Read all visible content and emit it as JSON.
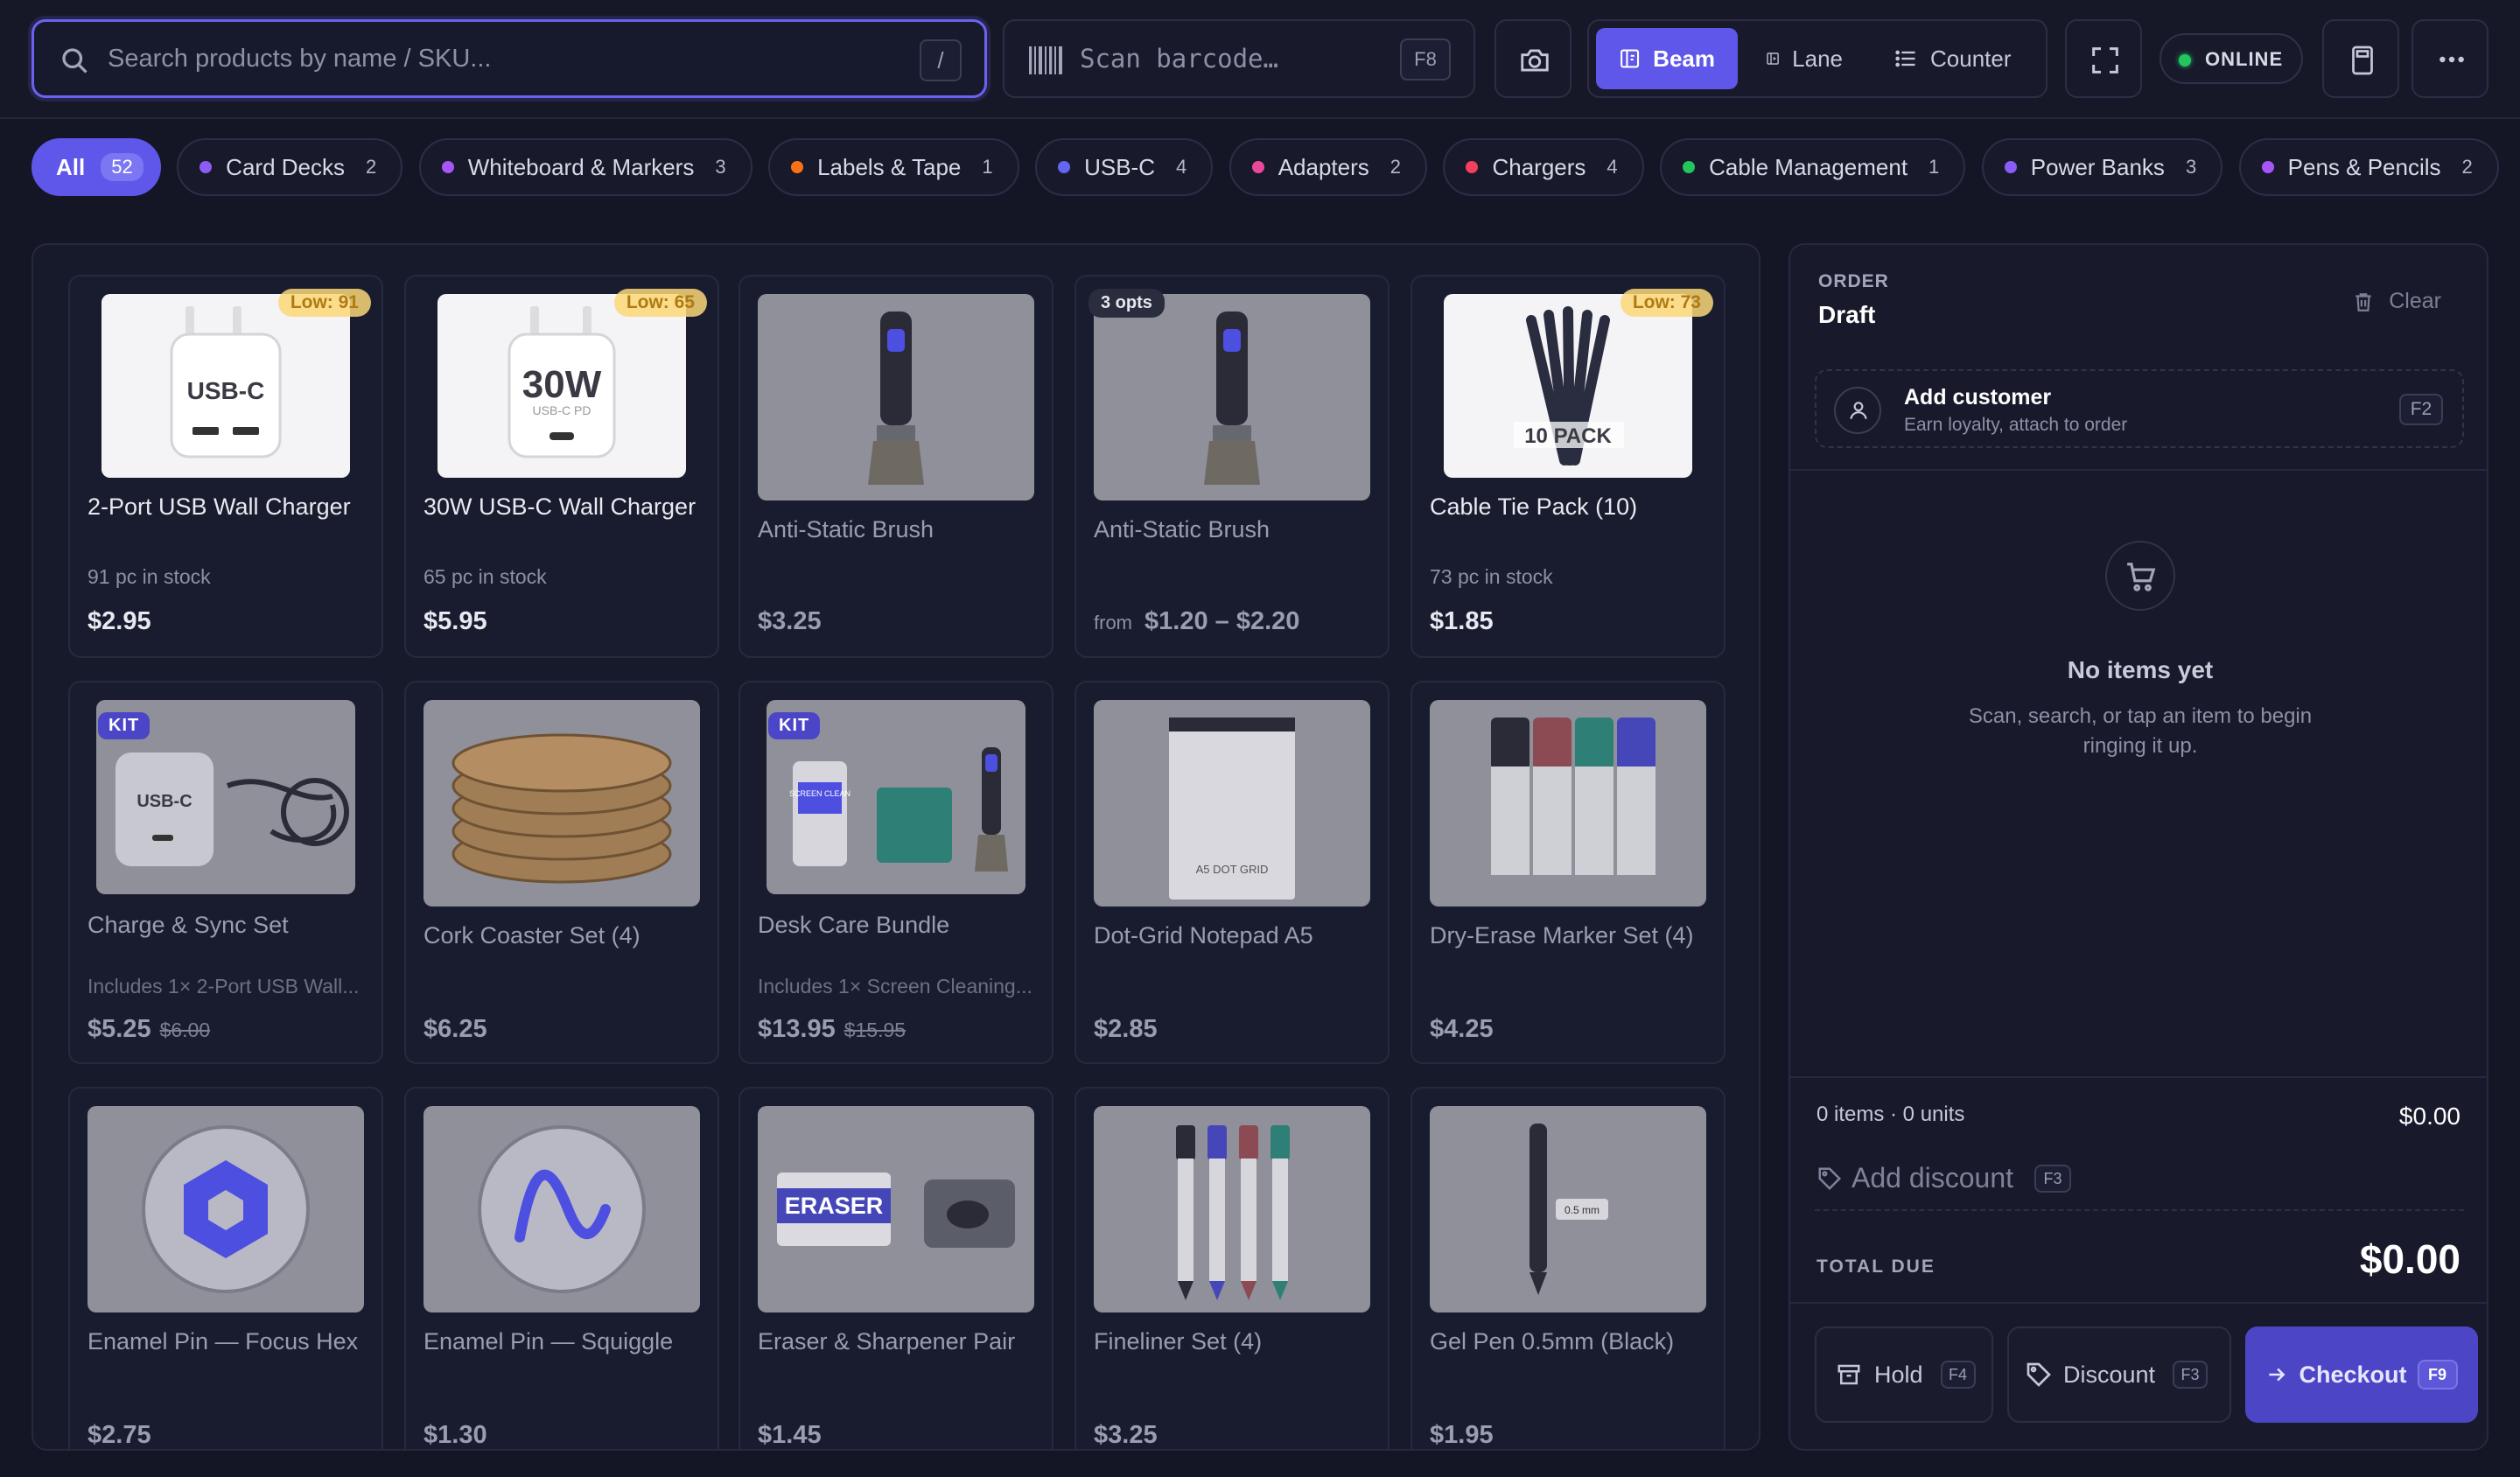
{
  "search": {
    "placeholder": "Search products by name / SKU...",
    "shortcut": "/"
  },
  "scan": {
    "placeholder": "Scan barcode…",
    "shortcut": "F8"
  },
  "modes": [
    {
      "label": "Beam",
      "active": true
    },
    {
      "label": "Lane",
      "active": false
    },
    {
      "label": "Counter",
      "active": false
    }
  ],
  "status": {
    "label": "ONLINE",
    "color": "#22c55e"
  },
  "accent": "#5e57ea",
  "categories": [
    {
      "label": "All",
      "count": "52",
      "active": true
    },
    {
      "label": "Card Decks",
      "count": "2",
      "color": "#8b5cf6"
    },
    {
      "label": "Whiteboard & Markers",
      "count": "3",
      "color": "#a855f7"
    },
    {
      "label": "Labels & Tape",
      "count": "1",
      "color": "#f97316"
    },
    {
      "label": "USB-C",
      "count": "4",
      "color": "#6366f1"
    },
    {
      "label": "Adapters",
      "count": "2",
      "color": "#ec4899"
    },
    {
      "label": "Chargers",
      "count": "4",
      "color": "#f43f5e"
    },
    {
      "label": "Cable Management",
      "count": "1",
      "color": "#22c55e"
    },
    {
      "label": "Power Banks",
      "count": "3",
      "color": "#8b5cf6"
    },
    {
      "label": "Pens & Pencils",
      "count": "2",
      "color": "#a855f7"
    }
  ],
  "products": [
    {
      "name": "2-Port USB Wall Charger",
      "stock": "91 pc in stock",
      "price": "$2.95",
      "badge": "Low: 91",
      "art": "USB-C"
    },
    {
      "name": "30W USB-C Wall Charger",
      "stock": "65 pc in stock",
      "price": "$5.95",
      "badge": "Low: 65",
      "art": "30W",
      "art_sub": "USB-C PD"
    },
    {
      "name": "Anti-Static Brush",
      "price": "$3.25"
    },
    {
      "name": "Anti-Static Brush",
      "price_from": "from",
      "price": "$1.20 – $2.20",
      "opts": "3 opts"
    },
    {
      "name": "Cable Tie Pack (10)",
      "stock": "73 pc in stock",
      "price": "$1.85",
      "badge": "Low: 73",
      "art": "10 PACK"
    },
    {
      "name": "Charge & Sync Set",
      "desc": "Includes 1× 2-Port USB Wall...",
      "price": "$5.25",
      "was": "$6.00",
      "kit": "KIT",
      "art": "USB-C"
    },
    {
      "name": "Cork Coaster Set (4)",
      "price": "$6.25"
    },
    {
      "name": "Desk Care Bundle",
      "desc": "Includes 1× Screen Cleaning...",
      "price": "$13.95",
      "was": "$15.95",
      "kit": "KIT",
      "art": "SCREEN CLEAN"
    },
    {
      "name": "Dot-Grid Notepad A5",
      "price": "$2.85",
      "art": "A5 DOT GRID"
    },
    {
      "name": "Dry-Erase Marker Set (4)",
      "price": "$4.25"
    },
    {
      "name": "Enamel Pin — Focus Hex",
      "price": "$2.75"
    },
    {
      "name": "Enamel Pin — Squiggle",
      "price": "$1.30"
    },
    {
      "name": "Eraser & Sharpener Pair",
      "price": "$1.45",
      "art": "ERASER"
    },
    {
      "name": "Fineliner Set (4)",
      "price": "$3.25"
    },
    {
      "name": "Gel Pen 0.5mm (Black)",
      "price": "$1.95",
      "art": "0.5 mm"
    }
  ],
  "order": {
    "label": "ORDER",
    "state": "Draft",
    "clear": "Clear",
    "customer": {
      "title": "Add customer",
      "subtitle": "Earn loyalty, attach to order",
      "shortcut": "F2"
    },
    "empty_title": "No items yet",
    "empty_body": "Scan, search, or tap an item to begin ringing it up.",
    "count_line": "0 items · 0 units",
    "subtotal": "$0.00",
    "add_discount": "Add discount",
    "add_discount_key": "F3",
    "total_label": "TOTAL DUE",
    "total": "$0.00",
    "hold": {
      "label": "Hold",
      "key": "F4"
    },
    "discount": {
      "label": "Discount",
      "key": "F3"
    },
    "checkout": {
      "label": "Checkout",
      "key": "F9"
    }
  }
}
